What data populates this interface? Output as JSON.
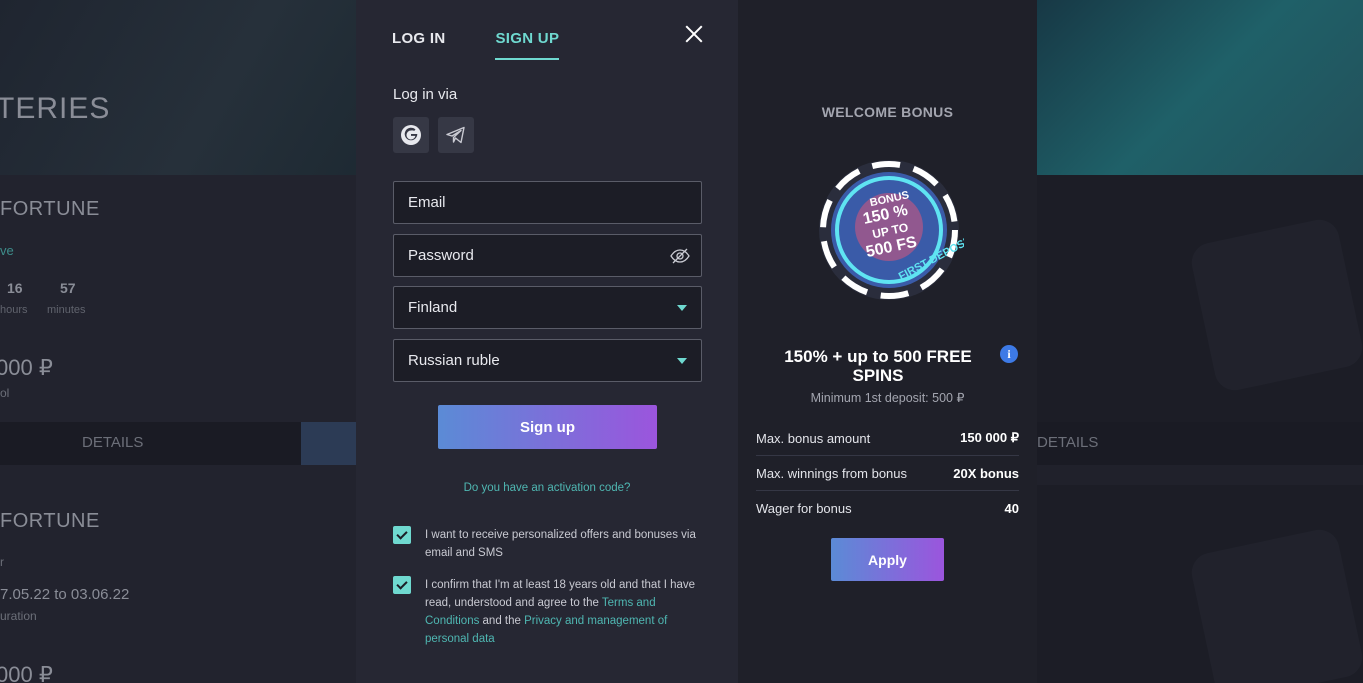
{
  "background": {
    "section_title": "TERIES",
    "card1": {
      "title": "FORTUNE",
      "status": "ve",
      "timer": [
        {
          "value": "16",
          "unit": "hours"
        },
        {
          "value": "57",
          "unit": "minutes"
        }
      ],
      "prize": "000 ₽",
      "prize_label": "ol",
      "details_label": "DETAILS"
    },
    "card2": {
      "title": "FORTUNE",
      "sub": "r",
      "dates": "7.05.22 to 03.06.22",
      "dates_label": "uration",
      "prize": "000 ₽"
    },
    "right_details_label": "DETAILS"
  },
  "auth": {
    "tabs": [
      {
        "label": "LOG IN",
        "active": false
      },
      {
        "label": "SIGN UP",
        "active": true
      }
    ],
    "login_via": "Log in via",
    "social": [
      {
        "icon": "google-icon"
      },
      {
        "icon": "telegram-icon"
      }
    ],
    "email_placeholder": "Email",
    "password_placeholder": "Password",
    "country": "Finland",
    "currency": "Russian ruble",
    "signup_label": "Sign up",
    "activation_link": "Do you have an activation code?",
    "consent1": "I want to receive personalized offers and bonuses via email and SMS",
    "consent2_pre": "I confirm that I'm at least 18 years old and that I have read, understood and agree to the ",
    "consent2_terms": "Terms and Conditions",
    "consent2_mid": " and the ",
    "consent2_privacy": "Privacy and management of personal data",
    "consent1_checked": true,
    "consent2_checked": true
  },
  "bonus": {
    "heading": "WELCOME BONUS",
    "chip_text": {
      "line1": "BONUS",
      "line2": "150 %",
      "line3": "UP TO",
      "line4": "500 FS",
      "arc": "FIRST DEPOSIT"
    },
    "offer": "150% + up to 500 FREE SPINS",
    "min_deposit": "Minimum 1st deposit: 500 ₽",
    "rows": [
      {
        "label": "Max. bonus amount",
        "value": "150 000 ₽"
      },
      {
        "label": "Max. winnings from bonus",
        "value": "20X bonus"
      },
      {
        "label": "Wager for bonus",
        "value": "40"
      }
    ],
    "apply_label": "Apply"
  },
  "colors": {
    "accent_teal": "#6fd9d0",
    "button_gradient_start": "#5b8bd6",
    "button_gradient_end": "#9b55dd",
    "modal_bg": "#262733"
  }
}
